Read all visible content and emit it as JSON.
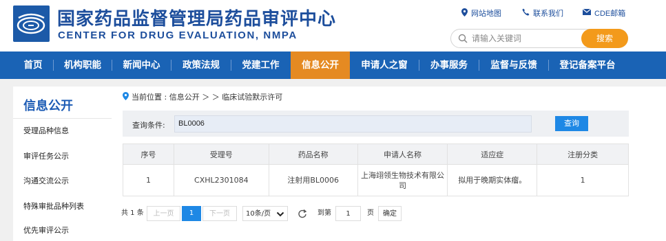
{
  "header": {
    "title_cn": "国家药品监督管理局药品审评中心",
    "title_en": "CENTER FOR DRUG EVALUATION, NMPA",
    "links": {
      "sitemap": "网站地图",
      "contact": "联系我们",
      "mail": "CDE邮箱"
    },
    "search": {
      "placeholder": "请输入关键词",
      "button": "搜索"
    }
  },
  "nav": {
    "items": [
      "首页",
      "机构职能",
      "新闻中心",
      "政策法规",
      "党建工作",
      "信息公开",
      "申请人之窗",
      "办事服务",
      "监督与反馈",
      "登记备案平台"
    ],
    "active": "信息公开"
  },
  "sidebar": {
    "title": "信息公开",
    "items": [
      "受理品种信息",
      "审评任务公示",
      "沟通交流公示",
      "特殊审批品种列表",
      "优先审评公示"
    ]
  },
  "breadcrumb": "当前位置 : 信息公开 ＞ ＞ 临床试验默示许可",
  "query": {
    "label": "查询条件:",
    "value": "BL0006",
    "button": "查询"
  },
  "table": {
    "headers": [
      "序号",
      "受理号",
      "药品名称",
      "申请人名称",
      "适应症",
      "注册分类"
    ],
    "rows": [
      [
        "1",
        "CXHL2301084",
        "注射用BL0006",
        "上海翊领生物技术有限公司",
        "拟用于晚期实体瘤。",
        "1"
      ]
    ]
  },
  "pager": {
    "total": "共 1 条",
    "prev": "上一页",
    "current": "1",
    "next": "下一页",
    "page_size": "10条/页",
    "goto_label": "到第",
    "goto_value": "1",
    "page_unit": "页",
    "confirm": "确定"
  },
  "colors": {
    "brand_blue": "#1a63b5",
    "active_orange": "#e58a22",
    "search_orange": "#f39a1b",
    "button_blue": "#1e88e5"
  },
  "icons": {
    "sitemap": "location-pin-icon",
    "contact": "phone-icon",
    "mail": "envelope-icon",
    "search": "magnifier-icon",
    "breadcrumb": "location-pin-icon",
    "refresh": "refresh-icon",
    "dropdown": "chevron-down-icon"
  }
}
